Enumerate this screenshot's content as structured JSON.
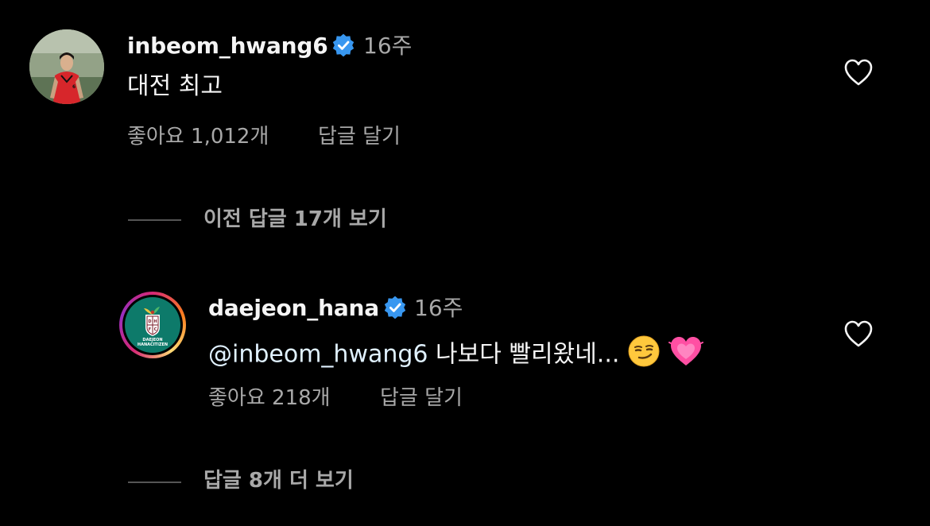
{
  "comments": [
    {
      "username": "inbeom_hwang6",
      "time": "16주",
      "text": "대전 최고",
      "likes": "좋아요 1,012개",
      "reply_label": "답글 달기",
      "avatar_icon": "user-photo-avatar",
      "verified": true
    },
    {
      "username": "daejeon_hana",
      "time": "16주",
      "mention": "@inbeom_hwang6",
      "text": " 나보다 빨리왔네...",
      "emojis": [
        "smirking-face-emoji",
        "growing-heart-emoji"
      ],
      "likes": "좋아요 218개",
      "reply_label": "답글 달기",
      "avatar_icon": "daejeon-hanacitizen-logo",
      "logo_text_line1": "DAEJEON",
      "logo_text_line2": "HANACITIZEN",
      "verified": true
    }
  ],
  "view_previous_replies": "이전 답글 17개 보기",
  "view_more_replies": "답글 8개 더 보기",
  "colors": {
    "background": "#000000",
    "primary_text": "#f5f5f5",
    "secondary_text": "#a8a8a8",
    "verified_blue": "#3897f0",
    "mention": "#e0f1ff"
  }
}
